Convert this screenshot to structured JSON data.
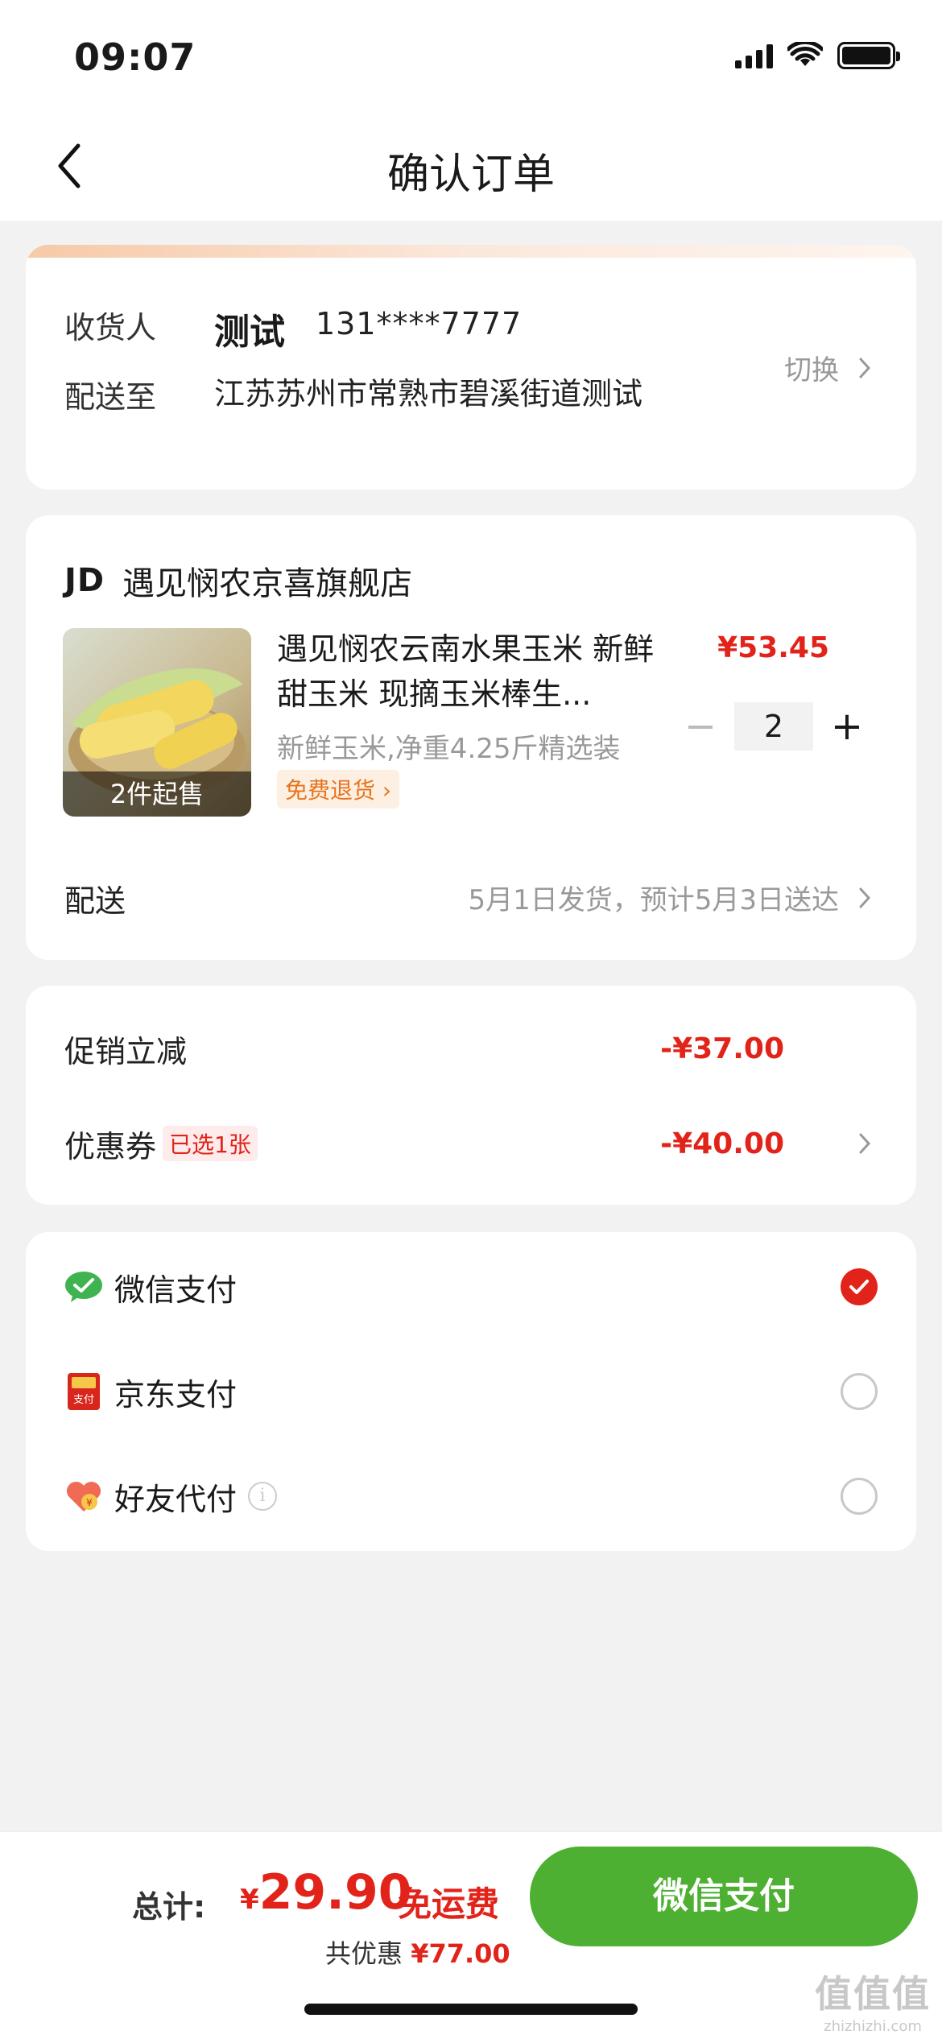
{
  "status_bar": {
    "time": "09:07"
  },
  "nav": {
    "title": "确认订单"
  },
  "address": {
    "receiver_label": "收货人",
    "receiver_name": "测试",
    "phone": "131****7777",
    "deliver_label": "配送至",
    "address_text": "江苏苏州市常熟市碧溪街道测试",
    "switch_label": "切换"
  },
  "order": {
    "store_logo": "JD",
    "store_name": "遇见悯农京喜旗舰店",
    "product": {
      "image_badge": "2件起售",
      "title": "遇见悯农云南水果玉米 新鲜甜玉米 现摘玉米棒生...",
      "price": "¥53.45",
      "spec": "新鲜玉米,净重4.25斤精选装",
      "return_tag": "免费退货",
      "quantity": "2"
    },
    "delivery_label": "配送",
    "delivery_info": "5月1日发货，预计5月3日送达"
  },
  "discounts": {
    "promo_label": "促销立减",
    "promo_value": "-¥37.00",
    "coupon_label": "优惠券",
    "coupon_tag": "已选1张",
    "coupon_value": "-¥40.00"
  },
  "payment_methods": [
    {
      "label": "微信支付",
      "icon": "wechat-pay-icon",
      "selected": true
    },
    {
      "label": "京东支付",
      "icon": "jd-pay-icon",
      "selected": false
    },
    {
      "label": "好友代付",
      "icon": "friend-pay-icon",
      "selected": false
    }
  ],
  "footer": {
    "total_label": "总计:",
    "currency": "¥",
    "total_amount": "29.90",
    "shipping": "免运费",
    "saving_label": "共优惠",
    "saving_amount": "¥77.00",
    "pay_button": "微信支付"
  },
  "watermark": {
    "main": "值值值",
    "sub": "zhizhizhi.com"
  },
  "colors": {
    "accent_red": "#e2231a",
    "pay_green": "#4eb032",
    "background": "#f2f2f2"
  }
}
